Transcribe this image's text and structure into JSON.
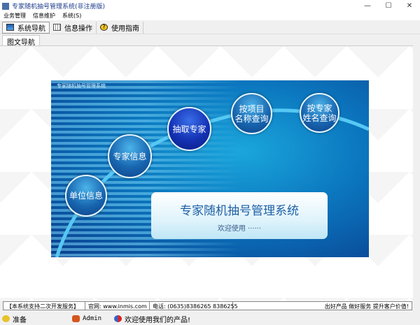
{
  "window": {
    "title": "专家随机抽号管理系统(非注册版)",
    "minimize": "—",
    "maximize": "☐",
    "close": "✕"
  },
  "menu": [
    "业务管理",
    "信息维护",
    "系统(S)"
  ],
  "toolbar": [
    {
      "label": "系统导航",
      "icon": "monitor-icon"
    },
    {
      "label": "信息操作",
      "icon": "grid-icon"
    },
    {
      "label": "使用指南",
      "icon": "help-icon"
    }
  ],
  "tab": "图文导航",
  "banner": {
    "title": "专家随机抽号管理系统",
    "buttons": [
      "单位信息",
      "专家信息",
      "抽取专家",
      "按项目\n名称查询",
      "按专家\n姓名查询"
    ],
    "main_title": "专家随机抽号管理系统",
    "welcome": "欢迎使用 ······"
  },
  "infobar": [
    "【本系统支持二次开发服务】",
    "官网: www.inmis.com",
    "电话: (0635)8386265 8386255",
    "出好产品 做好服务 提升客户价值!"
  ],
  "status": {
    "state": "准备",
    "user": "Admin",
    "message": "欢迎使用我们的产品!"
  }
}
